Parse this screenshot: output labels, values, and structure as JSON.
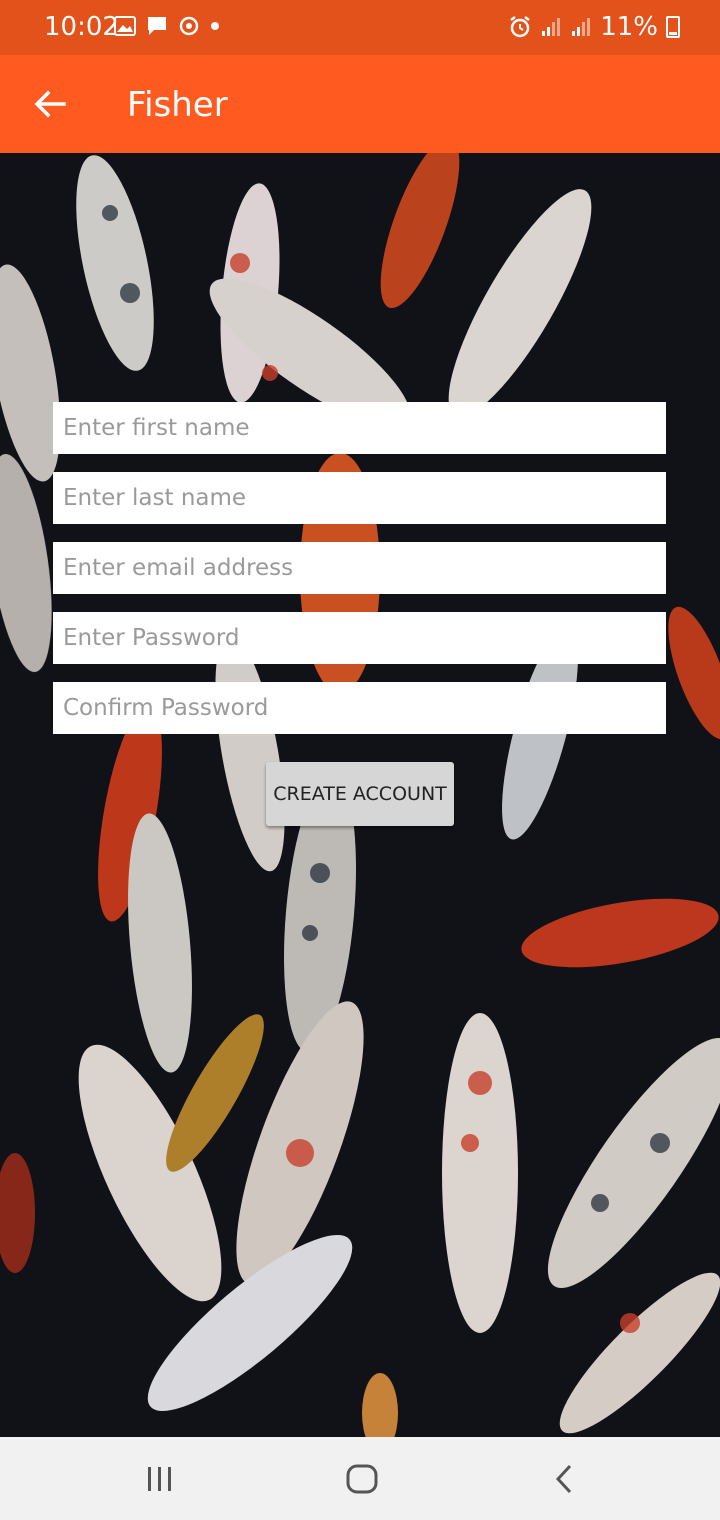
{
  "status_bar": {
    "time": "10:02",
    "battery": "11%",
    "icons_left": [
      "image-icon",
      "message-icon",
      "sync-icon",
      "dot-icon"
    ],
    "icons_right": [
      "alarm-icon",
      "signal-icon",
      "signal-icon",
      "battery-icon"
    ]
  },
  "app_bar": {
    "title": "Fisher",
    "back_icon": "arrow-left-icon",
    "color": "#ff5b21"
  },
  "form": {
    "first_name": {
      "placeholder": "Enter first name",
      "value": ""
    },
    "last_name": {
      "placeholder": "Enter last name",
      "value": ""
    },
    "email": {
      "placeholder": "Enter email address",
      "value": ""
    },
    "password": {
      "placeholder": "Enter Password",
      "value": ""
    },
    "confirm_password": {
      "placeholder": "Confirm Password",
      "value": ""
    },
    "submit_label": "CREATE ACCOUNT"
  },
  "nav_bar": {
    "recents_icon": "recents-icon",
    "home_icon": "home-icon",
    "back_icon": "back-chevron-icon"
  }
}
